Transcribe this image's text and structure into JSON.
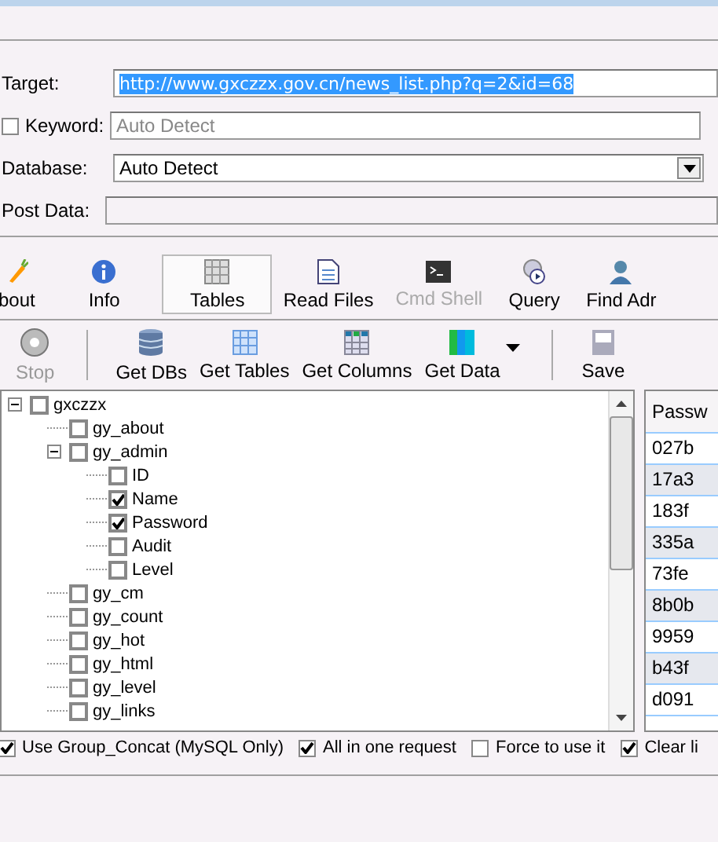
{
  "form": {
    "target": {
      "label": "Target:",
      "value": "http://www.gxczzx.gov.cn/news_list.php?q=2&id=68"
    },
    "keyword": {
      "label": "Keyword:",
      "checked": false,
      "placeholder": "Auto Detect"
    },
    "database": {
      "label": "Database:",
      "value": "Auto Detect"
    },
    "post_data": {
      "label": "Post Data:"
    }
  },
  "tabs": [
    {
      "label": "bout",
      "selected": false,
      "disabled": false
    },
    {
      "label": "Info",
      "selected": false,
      "disabled": false
    },
    {
      "label": "Tables",
      "selected": true,
      "disabled": false
    },
    {
      "label": "Read Files",
      "selected": false,
      "disabled": false
    },
    {
      "label": "Cmd Shell",
      "selected": false,
      "disabled": true
    },
    {
      "label": "Query",
      "selected": false,
      "disabled": false
    },
    {
      "label": "Find Adr",
      "selected": false,
      "disabled": false
    }
  ],
  "actions": [
    {
      "label": "Stop",
      "disabled": true
    },
    {
      "label": "Get DBs",
      "disabled": false
    },
    {
      "label": "Get Tables",
      "disabled": false
    },
    {
      "label": "Get Columns",
      "disabled": false
    },
    {
      "label": "Get Data",
      "disabled": false
    },
    {
      "label": "Save",
      "disabled": false
    }
  ],
  "tree": [
    {
      "label": "gxczzx",
      "checked": false,
      "expanded": true,
      "children": [
        {
          "label": "gy_about",
          "checked": false
        },
        {
          "label": "gy_admin",
          "checked": false,
          "expanded": true,
          "children": [
            {
              "label": "ID",
              "checked": false
            },
            {
              "label": "Name",
              "checked": true
            },
            {
              "label": "Password",
              "checked": true
            },
            {
              "label": "Audit",
              "checked": false
            },
            {
              "label": "Level",
              "checked": false
            }
          ]
        },
        {
          "label": "gy_cm",
          "checked": false
        },
        {
          "label": "gy_count",
          "checked": false
        },
        {
          "label": "gy_hot",
          "checked": false
        },
        {
          "label": "gy_html",
          "checked": false
        },
        {
          "label": "gy_level",
          "checked": false
        },
        {
          "label": "gy_links",
          "checked": false
        }
      ]
    }
  ],
  "results": {
    "header": "Passw",
    "rows": [
      "027b",
      "17a3",
      "183f",
      "335a",
      "73fe",
      "8b0b",
      "9959",
      "b43f",
      "d091"
    ]
  },
  "options": [
    {
      "label": "Use Group_Concat (MySQL Only)",
      "checked": true
    },
    {
      "label": "All in one request",
      "checked": true
    },
    {
      "label": "Force to use it",
      "checked": false
    },
    {
      "label": "Clear li",
      "checked": true
    }
  ]
}
